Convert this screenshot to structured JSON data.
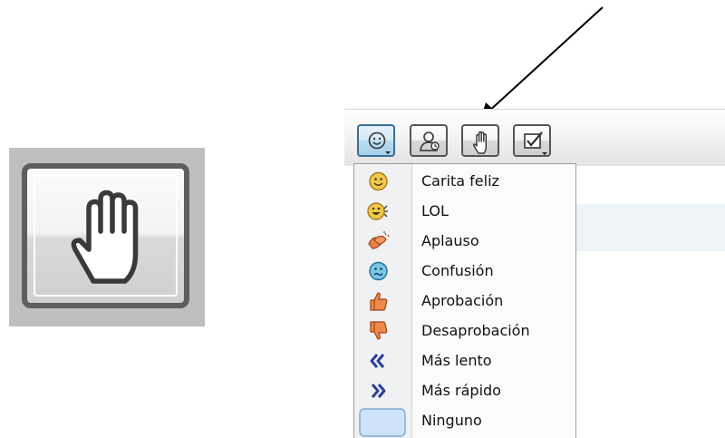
{
  "toolbar": {
    "buttons": [
      {
        "icon": "smiley-icon",
        "has_dropdown": true,
        "active": true
      },
      {
        "icon": "user-status-icon",
        "has_dropdown": false,
        "active": false
      },
      {
        "icon": "raise-hand-icon",
        "has_dropdown": false,
        "active": false
      },
      {
        "icon": "checkbox-icon",
        "has_dropdown": true,
        "active": false
      }
    ]
  },
  "menu": {
    "items": [
      {
        "label": "Carita feliz",
        "icon": "happy-face-icon"
      },
      {
        "label": "LOL",
        "icon": "lol-icon"
      },
      {
        "label": "Aplauso",
        "icon": "applause-icon"
      },
      {
        "label": "Confusión",
        "icon": "confused-face-icon"
      },
      {
        "label": "Aprobación",
        "icon": "thumbs-up-icon"
      },
      {
        "label": "Desaprobación",
        "icon": "thumbs-down-icon"
      },
      {
        "label": "Más lento",
        "icon": "slower-icon"
      },
      {
        "label": "Más rápido",
        "icon": "faster-icon"
      },
      {
        "label": "Ninguno",
        "icon": "none-swatch-icon"
      }
    ]
  },
  "colors": {
    "smiley": "#e8b93b",
    "confused": "#5fb0d8",
    "hand_orange": "#e0642b",
    "chevron_blue": "#2c3e99",
    "swatch_blue": "#cde3f7"
  }
}
